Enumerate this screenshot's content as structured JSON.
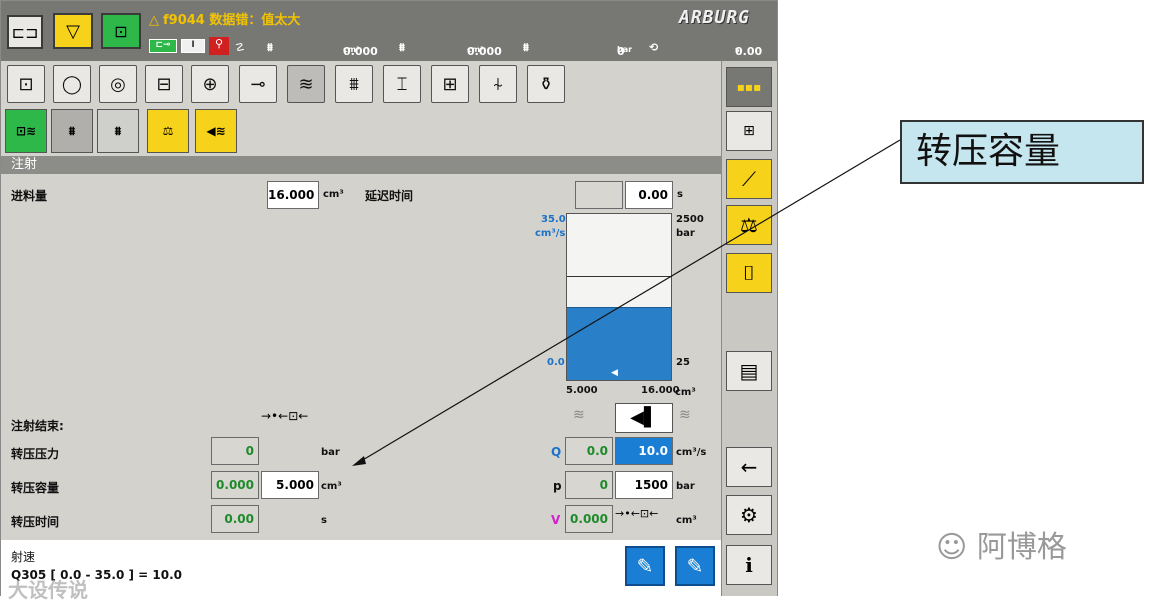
{
  "topbar": {
    "alarm_text": "f9044 数据错：值太大",
    "logo": "ARBURG",
    "status": {
      "vol1": "0.000",
      "vol1_unit": "cm³",
      "vol2": "0.000",
      "vol2_unit": "cm³",
      "pressure": "0",
      "pressure_unit": "bar",
      "time": "0.00",
      "time_unit": "s"
    }
  },
  "section_title": "注射",
  "dosing": {
    "label": "进料量",
    "value": "16.000",
    "unit": "cm³",
    "delay_label": "延迟时间",
    "delay_value": "0.00",
    "delay_unit": "s"
  },
  "graph": {
    "flow_max": "35.0",
    "flow_unit": "cm³/s",
    "pressure_max": "2500",
    "pressure_unit": "bar",
    "flow_min": "0.0",
    "pressure_min": "25",
    "x_min": "5.000",
    "x_max": "16.000",
    "x_unit": "cm³",
    "fill_fraction": 0.44
  },
  "switchover": {
    "end_label": "注射结束:",
    "pressure_label": "转压压力",
    "pressure_value": "0",
    "pressure_unit": "bar",
    "volume_label": "转压容量",
    "volume_actual": "0.000",
    "volume_value": "5.000",
    "volume_unit": "cm³",
    "time_label": "转压时间",
    "time_value": "0.00",
    "time_unit": "s"
  },
  "injection": {
    "q_label": "Q",
    "q_actual": "0.0",
    "q_set": "10.0",
    "q_unit": "cm³/s",
    "p_label": "p",
    "p_actual": "0",
    "p_set": "1500",
    "p_unit": "bar",
    "v_label": "V",
    "v_actual": "0.000",
    "v_unit": "cm³"
  },
  "bottom": {
    "title": "射速",
    "info": "Q305 [ 0.0 - 35.0 ] = 10.0"
  },
  "callout": {
    "text": "转压容量"
  },
  "wechat": {
    "text": "阿博格"
  },
  "watermark": "大设传说",
  "colors": {
    "accent_blue": "#1a7fd4",
    "highlight_yellow": "#f7d21a",
    "active_green": "#2eb84a"
  }
}
